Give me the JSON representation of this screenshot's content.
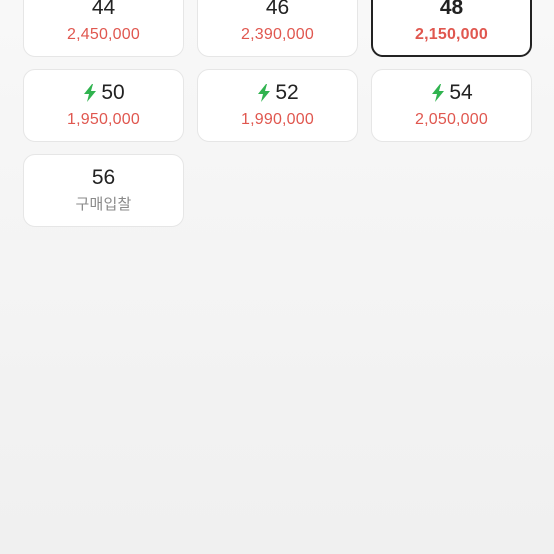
{
  "colors": {
    "price": "#e0574f",
    "muted": "#8a8a8a",
    "bolt": "#30b34f"
  },
  "sizes": [
    {
      "size": "44",
      "price": "2,450,000",
      "fast": false,
      "selected": false
    },
    {
      "size": "46",
      "price": "2,390,000",
      "fast": false,
      "selected": false
    },
    {
      "size": "48",
      "price": "2,150,000",
      "fast": false,
      "selected": true
    },
    {
      "size": "50",
      "price": "1,950,000",
      "fast": true,
      "selected": false
    },
    {
      "size": "52",
      "price": "1,990,000",
      "fast": true,
      "selected": false
    },
    {
      "size": "54",
      "price": "2,050,000",
      "fast": true,
      "selected": false
    },
    {
      "size": "56",
      "price": "구매입찰",
      "fast": false,
      "selected": false,
      "muted": true
    }
  ]
}
